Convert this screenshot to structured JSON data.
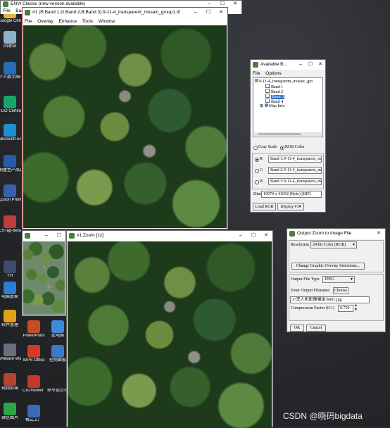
{
  "desktop": {
    "icons": [
      {
        "label": "Google Chrome",
        "color": "#e8b53a"
      },
      {
        "label": "回收站",
        "color": "#8fb1c9"
      },
      {
        "label": "个人数字图书馆2.1",
        "color": "#2b6cb3"
      },
      {
        "label": "TCO Certified",
        "color": "#19a36b"
      },
      {
        "label": "Microsoft Edge",
        "color": "#1f8fd0"
      },
      {
        "label": "测量生产品说明书",
        "color": "#2a5aa8"
      },
      {
        "label": "Epson Printer C...",
        "color": "#3a5fa8"
      },
      {
        "label": "CSTap-beta",
        "color": "#c23b3b"
      },
      {
        "label": "YH",
        "color": "#404b6b"
      },
      {
        "label": "电脑管家",
        "color": "#2c7dd6"
      },
      {
        "label": "软件管理",
        "color": "#e0a11a"
      },
      {
        "label": "VMware Workstati...",
        "color": "#6b6f7c"
      },
      {
        "label": "视频剪辑",
        "color": "#b5442f"
      },
      {
        "label": "微信图片",
        "color": "#2aa845"
      }
    ],
    "row_icons": [
      {
        "label": "PowerPoint",
        "color": "#c84b26"
      },
      {
        "label": "此电脑",
        "color": "#3d8ad8"
      },
      {
        "label": "WPS Office",
        "color": "#d23a2a"
      },
      {
        "label": "控制面板",
        "color": "#3a7bc8"
      },
      {
        "label": "CAJViewer 7.3",
        "color": "#c8352c"
      },
      {
        "label": "命令提示符",
        "color": "#222222"
      },
      {
        "label": "格式工厂",
        "color": "#3a6bb8"
      }
    ],
    "watermark": "CSDN @晓码bigdata"
  },
  "envi_main": {
    "title": "ENVI Classic (new version available)",
    "menu": [
      "File",
      "Basic"
    ]
  },
  "image_window": {
    "title": "#1 (R:Band 1,G:Band 2,B:Band 3):9-11-4_transparent_mosaic_group1.tif",
    "menu": [
      "File",
      "Overlay",
      "Enhance",
      "Tools",
      "Window"
    ]
  },
  "scroll_window": {
    "title": ""
  },
  "zoom_window": {
    "title": "#1 Zoom [1x]"
  },
  "available_bands": {
    "title": "Available B...",
    "menu": [
      "File",
      "Options"
    ],
    "tree": {
      "root": "9-11-4_transparent_mosaic_gro",
      "bands": [
        "Band 1",
        "Band 2",
        "Band 3",
        "Band 4"
      ],
      "selected_band": "Band 3",
      "map_info": "Map Info"
    },
    "mode": {
      "gray_label": "Gray Scale",
      "rgb_label": "RGB Color",
      "selected": "RGB Color"
    },
    "rows": [
      {
        "channel": "R",
        "value": "Band 1:9-11-4_transparent_mo"
      },
      {
        "channel": "G",
        "value": "Band 2:9-11-4_transparent_mo"
      },
      {
        "channel": "B",
        "value": "Band 3:9-11-4_transparent_mo"
      }
    ],
    "dims_label": "Dims",
    "dims_value": "19979 x 41692 (Byte) [BIP]",
    "load_button": "Load RGB",
    "display_button": "Display #1▾"
  },
  "output_zoom": {
    "title": "Output Zoom to Image File",
    "resolution_label": "Resolution",
    "resolution_value": "24-bit Color (RGB)",
    "overlay_button": "Change Graphic Overlay Selections...",
    "file_type_label": "Output File Type",
    "file_type_value": "JPEG",
    "filename_label": "Enter Output Filename",
    "choose_button": "Choose",
    "filename_value": "J:\\无人机影像输出\\b001.jpg",
    "compression_label": "Compression Factor (0-1)",
    "compression_value": "0.750",
    "ok_button": "OK",
    "cancel_button": "Cancel"
  }
}
